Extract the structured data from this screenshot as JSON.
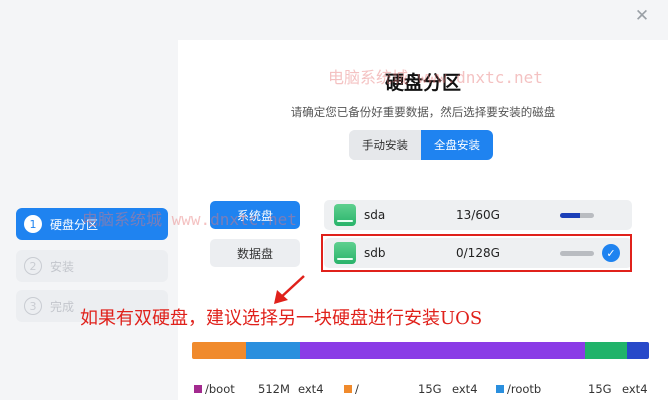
{
  "window": {
    "close_glyph": "✕"
  },
  "sidebar": {
    "steps": [
      {
        "num": "1",
        "label": "硬盘分区",
        "state": "active"
      },
      {
        "num": "2",
        "label": "安装",
        "state": "inactive"
      },
      {
        "num": "3",
        "label": "完成",
        "state": "inactive"
      }
    ]
  },
  "header": {
    "title": "硬盘分区",
    "subtitle": "请确定您已备份好重要数据，然后选择要安装的磁盘"
  },
  "mode": {
    "manual_label": "手动安装",
    "full_label": "全盘安装",
    "selected": "全盘安装"
  },
  "disk_tabs": {
    "system_label": "系统盘",
    "data_label": "数据盘"
  },
  "disks": [
    {
      "name": "sda",
      "size": "13/60G",
      "usage_fraction": 0.6,
      "selected": false
    },
    {
      "name": "sdb",
      "size": "0/128G",
      "usage_fraction": 0.0,
      "selected": true
    }
  ],
  "check_glyph": "✓",
  "annotation": "如果有双硬盘，建议选择另一块硬盘进行安装UOS",
  "watermarks": {
    "top": "电脑系统城 www.dnxtc.net",
    "middle": "电脑系统城 www.dnxtc.net"
  },
  "partitions": [
    {
      "mount": "/boot",
      "size": "512M",
      "fs": "ext4",
      "color": "#a32a8f"
    },
    {
      "mount": "/",
      "size": "15G",
      "fs": "ext4",
      "color": "#f08a2c"
    },
    {
      "mount": "/rootb",
      "size": "15G",
      "fs": "ext4",
      "color": "#2a8fde"
    }
  ],
  "part_bar": {
    "segments": [
      {
        "color": "#f08a2c"
      },
      {
        "color": "#2a8fde"
      },
      {
        "color": "#8a3be6"
      },
      {
        "color": "#20b36a"
      },
      {
        "color": "#2749c9"
      }
    ]
  },
  "accent_color": "#1f83f0",
  "highlight_color": "#e0211b"
}
